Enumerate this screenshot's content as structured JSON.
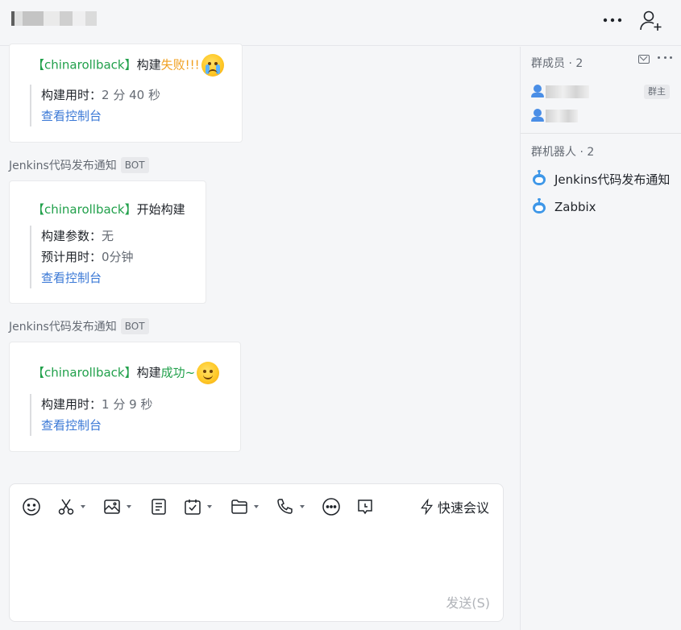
{
  "header": {
    "title_redacted": true
  },
  "messages": [
    {
      "sender": "",
      "project": "【chinarollback】",
      "action_prefix": "构建",
      "action_status": "失败!!!",
      "status_type": "fail",
      "emoji": "crying-face-icon",
      "fields": [
        {
          "key": "构建用时：",
          "value": "2 分 40 秒"
        }
      ],
      "link": "查看控制台"
    },
    {
      "sender": "Jenkins代码发布通知",
      "badge": "BOT",
      "project": "【chinarollback】",
      "action_prefix": "开始构建",
      "fields": [
        {
          "key": "构建参数：",
          "value": "无"
        },
        {
          "key": "预计用时：",
          "value": "0分钟"
        }
      ],
      "link": "查看控制台"
    },
    {
      "sender": "Jenkins代码发布通知",
      "badge": "BOT",
      "project": "【chinarollback】",
      "action_prefix": "构建",
      "action_status": "成功~",
      "status_type": "success",
      "emoji": "smiling-face-icon",
      "fields": [
        {
          "key": "构建用时：",
          "value": "1 分 9 秒"
        }
      ],
      "link": "查看控制台"
    }
  ],
  "composer": {
    "tools": [
      "emoji-icon",
      "scissors-icon",
      "image-icon",
      "document-icon",
      "calendar-check-icon",
      "folder-icon",
      "phone-icon",
      "more-circle-icon",
      "feedback-icon"
    ],
    "meeting_label": "快速会议",
    "send_label": "发送(S)"
  },
  "sidebar": {
    "members_header": "群成员 · 2",
    "members": [
      {
        "name_redacted": true,
        "role": "群主"
      },
      {
        "name_redacted": true
      }
    ],
    "bots_header": "群机器人 · 2",
    "bots": [
      {
        "name": "Jenkins代码发布通知"
      },
      {
        "name": "Zabbix"
      }
    ]
  },
  "colors": {
    "accent_green": "#21a04b",
    "warning_orange": "#f0a020",
    "link_blue": "#3a78d6",
    "bot_blue": "#3e97e8"
  }
}
